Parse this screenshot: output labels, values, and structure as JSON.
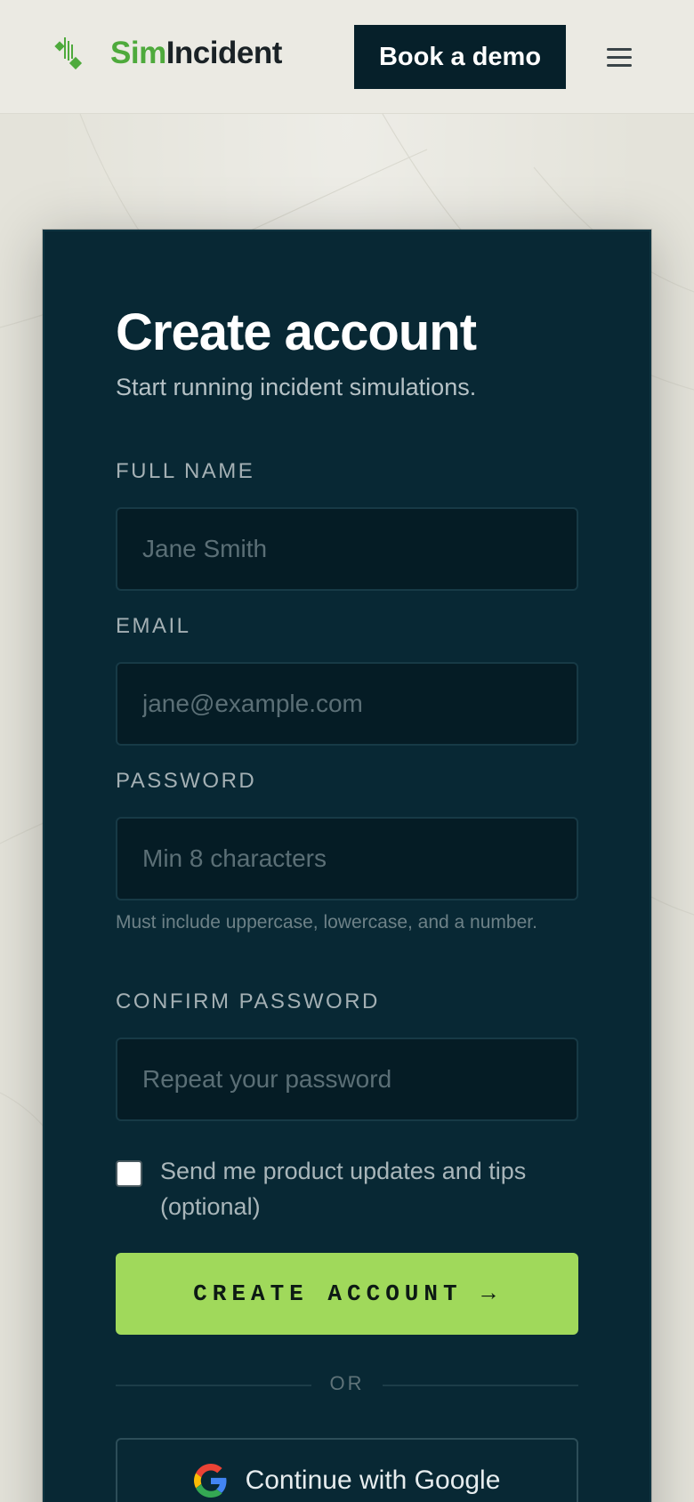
{
  "header": {
    "brand_prefix": "Sim",
    "brand_suffix": "Incident",
    "demo_label": "Book a demo",
    "menu_icon": "hamburger-menu-icon",
    "brand_color": "#4eaa3c"
  },
  "form": {
    "title": "Create account",
    "subtitle": "Start running incident simulations.",
    "fields": [
      {
        "label": "FULL NAME",
        "placeholder": "Jane Smith",
        "value": ""
      },
      {
        "label": "EMAIL",
        "placeholder": "jane@example.com",
        "value": ""
      },
      {
        "label": "PASSWORD",
        "placeholder": "Min 8 characters",
        "value": ""
      },
      {
        "label": "CONFIRM PASSWORD",
        "placeholder": "Repeat your password",
        "value": ""
      }
    ],
    "password_hint": "Must include uppercase, lowercase, and a number.",
    "updates_checkbox_label": "Send me product updates and tips (optional)",
    "updates_checked": false,
    "submit_label": "CREATE ACCOUNT →",
    "submit_color": "#a0d95b",
    "divider_text": "OR",
    "google_label": "Continue with Google",
    "google_icon": "google-icon"
  },
  "colors": {
    "card_background": "#082834",
    "page_background": "#e9e8e0"
  }
}
